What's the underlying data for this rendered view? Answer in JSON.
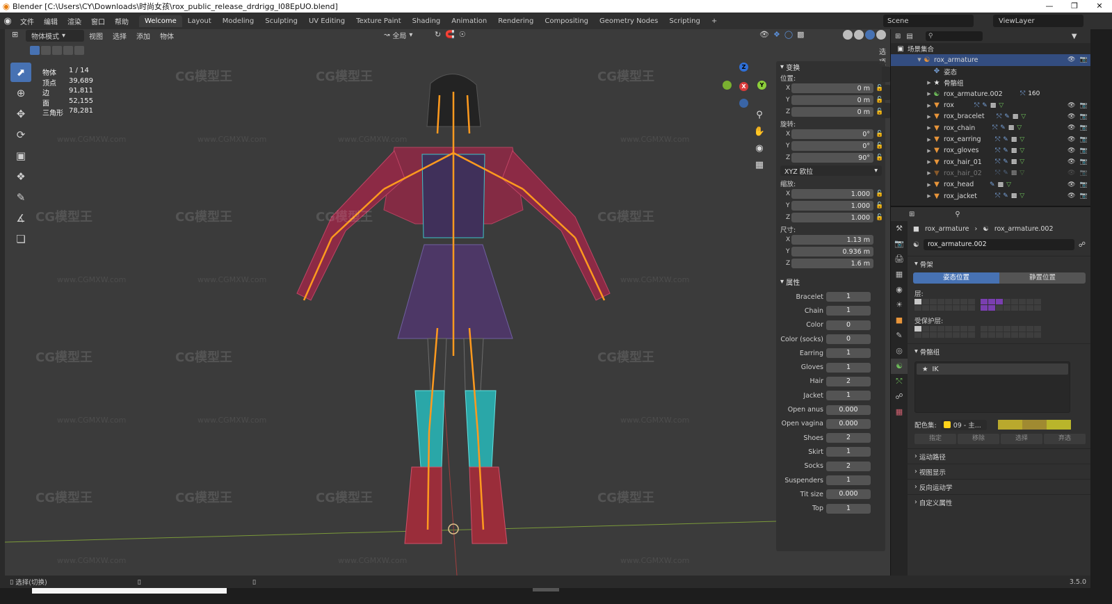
{
  "window": {
    "title": "Blender [C:\\Users\\CY\\Downloads\\时尚女孩\\rox_public_release_drdrigg_l08EpUO.blend]",
    "controls": [
      "—",
      "❐",
      "✕"
    ]
  },
  "menu": {
    "items": [
      "文件",
      "编辑",
      "渲染",
      "窗口",
      "帮助"
    ],
    "workspaces": [
      "Welcome",
      "Layout",
      "Modeling",
      "Sculpting",
      "UV Editing",
      "Texture Paint",
      "Shading",
      "Animation",
      "Rendering",
      "Compositing",
      "Geometry Nodes",
      "Scripting"
    ],
    "add_tab": "+",
    "scene": "Scene",
    "view_layer": "ViewLayer"
  },
  "viewport": {
    "mode": "物体模式",
    "menus": [
      "视图",
      "选择",
      "添加",
      "物体"
    ],
    "pivot": "全局",
    "options": "选项",
    "stats": [
      {
        "label": "物体",
        "value": "1 / 14"
      },
      {
        "label": "顶点",
        "value": "39,689"
      },
      {
        "label": "边",
        "value": "91,811"
      },
      {
        "label": "面",
        "value": "52,155"
      },
      {
        "label": "三角形",
        "value": "78,281"
      }
    ],
    "gizmo": {
      "x": "X",
      "y": "Y",
      "z": "Z"
    },
    "watermark_text": "CG模型王",
    "watermark_url": "www.CGMXW.com"
  },
  "npanel": {
    "transform_header": "变换",
    "location_label": "位置:",
    "location": [
      {
        "axis": "X",
        "value": "0 m"
      },
      {
        "axis": "Y",
        "value": "0 m"
      },
      {
        "axis": "Z",
        "value": "0 m"
      }
    ],
    "rotation_label": "旋转:",
    "rotation": [
      {
        "axis": "X",
        "value": "0°"
      },
      {
        "axis": "Y",
        "value": "0°"
      },
      {
        "axis": "Z",
        "value": "90°"
      }
    ],
    "rotation_mode": "XYZ 欧拉",
    "scale_label": "缩放:",
    "scale": [
      {
        "axis": "X",
        "value": "1.000"
      },
      {
        "axis": "Y",
        "value": "1.000"
      },
      {
        "axis": "Z",
        "value": "1.000"
      }
    ],
    "dimensions_label": "尺寸:",
    "dimensions": [
      {
        "axis": "X",
        "value": "1.13 m"
      },
      {
        "axis": "Y",
        "value": "0.936 m"
      },
      {
        "axis": "Z",
        "value": "1.6 m"
      }
    ],
    "properties_header": "属性",
    "properties": [
      {
        "name": "Bracelet",
        "value": "1"
      },
      {
        "name": "Chain",
        "value": "1"
      },
      {
        "name": "Color",
        "value": "0"
      },
      {
        "name": "Color (socks)",
        "value": "0"
      },
      {
        "name": "Earring",
        "value": "1"
      },
      {
        "name": "Gloves",
        "value": "1"
      },
      {
        "name": "Hair",
        "value": "2"
      },
      {
        "name": "Jacket",
        "value": "1"
      },
      {
        "name": "Open anus",
        "value": "0.000"
      },
      {
        "name": "Open vagina",
        "value": "0.000"
      },
      {
        "name": "Shoes",
        "value": "2"
      },
      {
        "name": "Skirt",
        "value": "1"
      },
      {
        "name": "Socks",
        "value": "2"
      },
      {
        "name": "Suspenders",
        "value": "1"
      },
      {
        "name": "Tit size",
        "value": "0.000"
      },
      {
        "name": "Top",
        "value": "1"
      }
    ]
  },
  "outliner": {
    "root": "场景集合",
    "rows": [
      {
        "name": "rox_armature",
        "icon": "armature-icon",
        "selected": true,
        "dim": false
      },
      {
        "name": "姿态",
        "icon": "pose-icon",
        "selected": false,
        "dim": false
      },
      {
        "name": "骨骼组",
        "icon": "bone-group-icon",
        "selected": false,
        "dim": false
      },
      {
        "name": "rox_armature.002",
        "icon": "armature-data-icon",
        "selected": false,
        "dim": false,
        "extra": "160"
      },
      {
        "name": "rox",
        "icon": "mesh-icon",
        "selected": false,
        "dim": false
      },
      {
        "name": "rox_bracelet",
        "icon": "mesh-icon",
        "selected": false,
        "dim": false
      },
      {
        "name": "rox_chain",
        "icon": "mesh-icon",
        "selected": false,
        "dim": false
      },
      {
        "name": "rox_earring",
        "icon": "mesh-icon",
        "selected": false,
        "dim": false
      },
      {
        "name": "rox_gloves",
        "icon": "mesh-icon",
        "selected": false,
        "dim": false
      },
      {
        "name": "rox_hair_01",
        "icon": "mesh-icon",
        "selected": false,
        "dim": false
      },
      {
        "name": "rox_hair_02",
        "icon": "mesh-icon",
        "selected": false,
        "dim": true
      },
      {
        "name": "rox_head",
        "icon": "mesh-icon",
        "selected": false,
        "dim": false
      },
      {
        "name": "rox_jacket",
        "icon": "mesh-icon",
        "selected": false,
        "dim": false
      }
    ]
  },
  "properties": {
    "breadcrumb_object": "rox_armature",
    "breadcrumb_data": "rox_armature.002",
    "data_name": "rox_armature.002",
    "skeleton_header": "骨架",
    "pose_position": "姿态位置",
    "rest_position": "静置位置",
    "layers_label": "层:",
    "protected_layers_label": "受保护层:",
    "bone_groups_header": "骨骼组",
    "bone_group_item": "IK",
    "color_set_label": "配色集:",
    "color_set_value": "09 - 主...",
    "assign": "指定",
    "remove": "移除",
    "select": "选择",
    "deselect": "弃选",
    "motion_paths": "运动路径",
    "viewport_display": "视图显示",
    "inverse_kinematics": "反向运动学",
    "custom_properties": "自定义属性",
    "color_set_colors": [
      "#b9a92d",
      "#a08a31",
      "#b9b52b"
    ]
  },
  "statusbar": {
    "hint": "选择(切换)",
    "version": "3.5.0"
  }
}
